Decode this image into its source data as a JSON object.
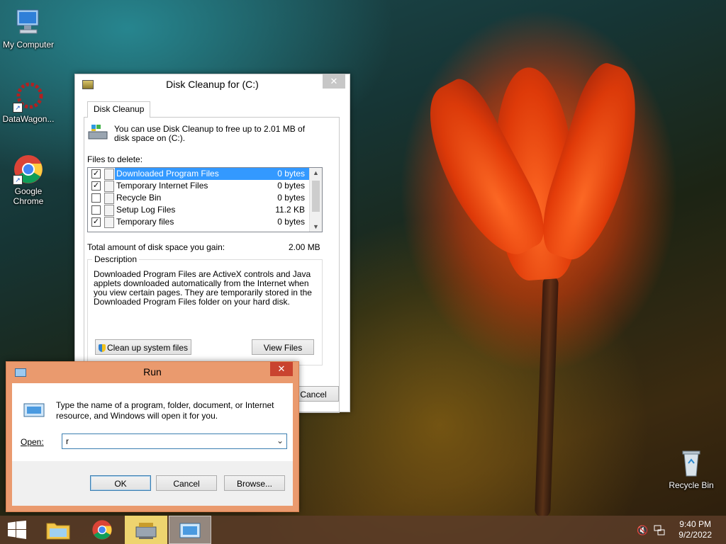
{
  "desktop": {
    "icons": [
      {
        "label": "My Computer"
      },
      {
        "label": "DataWagon..."
      },
      {
        "label": "Google Chrome"
      },
      {
        "label": "Recycle Bin"
      }
    ]
  },
  "disk_cleanup": {
    "title": "Disk Cleanup for  (C:)",
    "tab": "Disk Cleanup",
    "intro": "You can use Disk Cleanup to free up to 2.01 MB of disk space on  (C:).",
    "files_label": "Files to delete:",
    "files": [
      {
        "name": "Downloaded Program Files",
        "size": "0 bytes",
        "checked": true,
        "selected": true
      },
      {
        "name": "Temporary Internet Files",
        "size": "0 bytes",
        "checked": true,
        "selected": false
      },
      {
        "name": "Recycle Bin",
        "size": "0 bytes",
        "checked": false,
        "selected": false
      },
      {
        "name": "Setup Log Files",
        "size": "11.2 KB",
        "checked": false,
        "selected": false
      },
      {
        "name": "Temporary files",
        "size": "0 bytes",
        "checked": true,
        "selected": false
      }
    ],
    "total_label": "Total amount of disk space you gain:",
    "total_value": "2.00 MB",
    "description_legend": "Description",
    "description": "Downloaded Program Files are ActiveX controls and Java applets downloaded automatically from the Internet when you view certain pages. They are temporarily stored in the Downloaded Program Files folder on your hard disk.",
    "cleanup_system_label": "Clean up system files",
    "view_files_label": "View Files",
    "cancel_label": "Cancel"
  },
  "run": {
    "title": "Run",
    "close": "✕",
    "prompt": "Type the name of a program, folder, document, or Internet resource, and Windows will open it for you.",
    "open_label": "Open:",
    "open_value": "r",
    "ok_label": "OK",
    "cancel_label": "Cancel",
    "browse_label": "Browse..."
  },
  "taskbar": {
    "time": "9:40 PM",
    "date": "9/2/2022"
  }
}
